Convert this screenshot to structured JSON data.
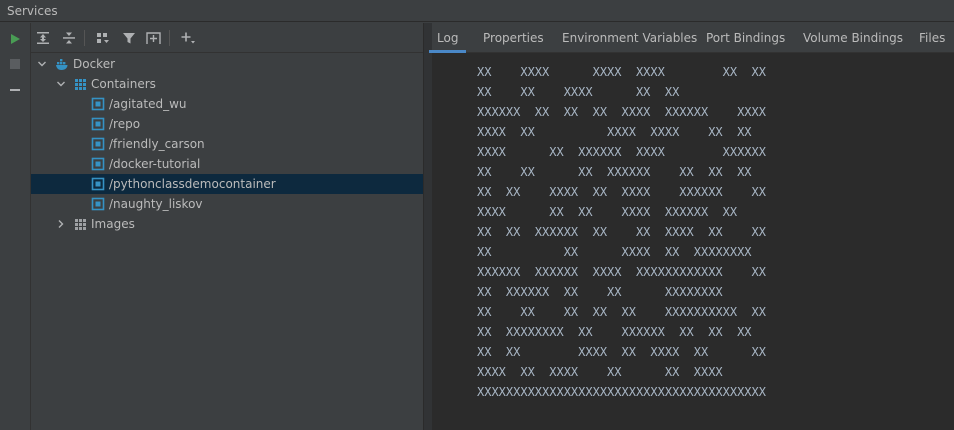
{
  "window": {
    "title": "Services"
  },
  "toolbar_icons": [
    "run-icon",
    "expand-all-icon",
    "collapse-all-icon",
    "group-by-icon",
    "filter-icon",
    "new-tab-icon",
    "add-icon"
  ],
  "left_strip_icons": [
    "run-icon",
    "stop-icon",
    "minimize-icon"
  ],
  "tree": {
    "root": {
      "label": "Docker",
      "icon": "docker-icon"
    },
    "containers_group": {
      "label": "Containers",
      "icon": "containers-group-icon"
    },
    "containers": [
      {
        "label": "/agitated_wu",
        "selected": false
      },
      {
        "label": "/repo",
        "selected": false
      },
      {
        "label": "/friendly_carson",
        "selected": false
      },
      {
        "label": "/docker-tutorial",
        "selected": false
      },
      {
        "label": "/pythonclassdemocontainer",
        "selected": true
      },
      {
        "label": "/naughty_liskov",
        "selected": false
      }
    ],
    "images_group": {
      "label": "Images",
      "icon": "images-group-icon"
    }
  },
  "tabs": [
    {
      "label": "Log",
      "active": true
    },
    {
      "label": "Properties",
      "active": false
    },
    {
      "label": "Environment Variables",
      "active": false
    },
    {
      "label": "Port Bindings",
      "active": false
    },
    {
      "label": "Volume Bindings",
      "active": false
    },
    {
      "label": "Files",
      "active": false
    }
  ],
  "log_lines": [
    "XX    XXXX      XXXX  XXXX        XX  XX",
    "XX    XX    XXXX      XX  XX",
    "XXXXXX  XX  XX  XX  XXXX  XXXXXX    XXXX",
    "XXXX  XX          XXXX  XXXX    XX  XX",
    "XXXX      XX  XXXXXX  XXXX        XXXXXX",
    "XX    XX      XX  XXXXXX    XX  XX  XX",
    "XX  XX    XXXX  XX  XXXX    XXXXXX    XX",
    "XXXX      XX  XX    XXXX  XXXXXX  XX",
    "XX  XX  XXXXXX  XX    XX  XXXX  XX    XX",
    "XX          XX      XXXX  XX  XXXXXXXX",
    "XXXXXX  XXXXXX  XXXX  XXXXXXXXXXXX    XX",
    "XX  XXXXXX  XX    XX      XXXXXXXX",
    "XX    XX    XX  XX  XX    XXXXXXXXXX  XX",
    "XX  XXXXXXXX  XX    XXXXXX  XX  XX  XX",
    "XX  XX        XXXX  XX  XXXX  XX      XX",
    "XXXX  XX  XXXX    XX      XX  XXXX",
    "XXXXXXXXXXXXXXXXXXXXXXXXXXXXXXXXXXXXXXXX"
  ]
}
